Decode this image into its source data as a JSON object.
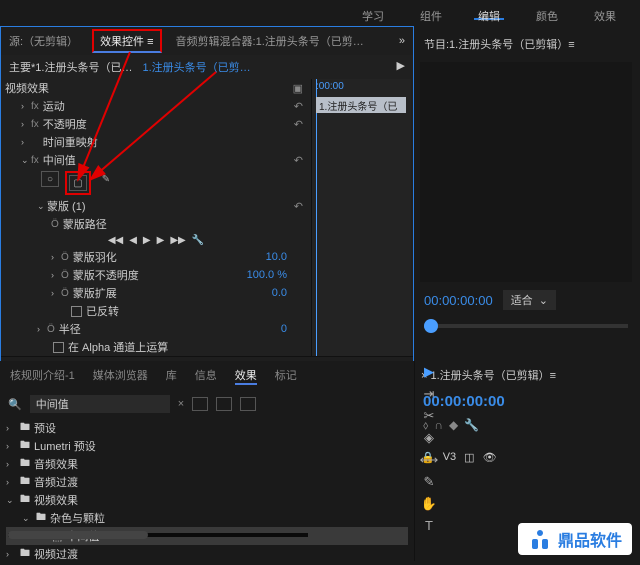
{
  "top_tabs": {
    "learn": "学习",
    "components": "组件",
    "edit": "编辑",
    "color": "颜色",
    "effects": "效果"
  },
  "panel_tabs": {
    "source": "源:（无剪辑）",
    "effect_controls": "效果控件 ≡",
    "audio_mixer": "音频剪辑混合器:1.注册头条号（已剪…"
  },
  "header": {
    "master": "主要*1.注册头条号（已…",
    "clip": "1.注册头条号（已剪…"
  },
  "clip_name": "1.注册头条号（已",
  "timescale": ":00:00",
  "effects": {
    "video_effects": "视频效果",
    "motion": "运动",
    "opacity": "不透明度",
    "time_remap": "时间重映射",
    "median": "中间值",
    "mask": "蒙版 (1)",
    "mask_path": "蒙版路径",
    "mask_feather": "蒙版羽化",
    "mask_feather_val": "10.0",
    "mask_opacity": "蒙版不透明度",
    "mask_opacity_val": "100.0 %",
    "mask_expansion": "蒙版扩展",
    "mask_expansion_val": "0.0",
    "inverted": "已反转",
    "radius": "半径",
    "radius_val": "0",
    "use_alpha": "在 Alpha 通道上运算"
  },
  "timecode": "00:00:00:00",
  "right": {
    "header": "节目:1.注册头条号（已剪辑）≡",
    "tc": "00:00:00:00",
    "fit": "适合"
  },
  "lower_tabs": {
    "t1": "核规则介绍-1",
    "t2": "媒体浏览器",
    "t3": "库",
    "t4": "信息",
    "t5": "效果",
    "t6": "标记"
  },
  "search": "中间值",
  "tree": {
    "presets": "预设",
    "lumetri": "Lumetri 预设",
    "audio_fx": "音频效果",
    "audio_tr": "音频过渡",
    "video_fx": "视频效果",
    "noise": "杂色与颗粒",
    "median": "中间值",
    "video_tr": "视频过渡"
  },
  "seq": {
    "title": "× 1.注册头条号（已剪辑）≡",
    "tc": "00:00:00:00",
    "v3": "V3"
  },
  "watermark": "鼎品软件"
}
